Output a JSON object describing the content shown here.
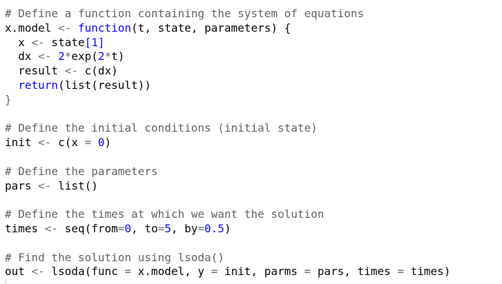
{
  "editor": {
    "lines": [
      [
        {
          "t": "# Define a function containing the system of equations",
          "c": "comment"
        }
      ],
      [
        {
          "t": "x.model",
          "c": "id"
        },
        {
          "t": " ",
          "c": "id"
        },
        {
          "t": "<-",
          "c": "op"
        },
        {
          "t": " ",
          "c": "id"
        },
        {
          "t": "function",
          "c": "kw"
        },
        {
          "t": "(t, state, parameters) {",
          "c": "id"
        }
      ],
      [
        {
          "t": "  x ",
          "c": "id"
        },
        {
          "t": "<-",
          "c": "op"
        },
        {
          "t": " state",
          "c": "id"
        },
        {
          "t": "[",
          "c": "kw"
        },
        {
          "t": "1",
          "c": "num"
        },
        {
          "t": "]",
          "c": "kw"
        }
      ],
      [
        {
          "t": "  dx ",
          "c": "id"
        },
        {
          "t": "<-",
          "c": "op"
        },
        {
          "t": " ",
          "c": "id"
        },
        {
          "t": "2",
          "c": "num"
        },
        {
          "t": "*",
          "c": "op"
        },
        {
          "t": "exp(",
          "c": "id"
        },
        {
          "t": "2",
          "c": "num"
        },
        {
          "t": "*",
          "c": "op"
        },
        {
          "t": "t)",
          "c": "id"
        }
      ],
      [
        {
          "t": "  result ",
          "c": "id"
        },
        {
          "t": "<-",
          "c": "op"
        },
        {
          "t": " c(dx)",
          "c": "id"
        }
      ],
      [
        {
          "t": "  ",
          "c": "id"
        },
        {
          "t": "return",
          "c": "kw"
        },
        {
          "t": "(list(result))",
          "c": "id"
        }
      ],
      [
        {
          "t": "}",
          "c": "op"
        }
      ],
      [
        {
          "t": "",
          "c": "id"
        }
      ],
      [
        {
          "t": "# Define the initial conditions (initial state)",
          "c": "comment"
        }
      ],
      [
        {
          "t": "init ",
          "c": "id"
        },
        {
          "t": "<-",
          "c": "op"
        },
        {
          "t": " c(x ",
          "c": "id"
        },
        {
          "t": "=",
          "c": "op"
        },
        {
          "t": " ",
          "c": "id"
        },
        {
          "t": "0",
          "c": "num"
        },
        {
          "t": ")",
          "c": "id"
        }
      ],
      [
        {
          "t": "",
          "c": "id"
        }
      ],
      [
        {
          "t": "# Define the parameters",
          "c": "comment"
        }
      ],
      [
        {
          "t": "pars ",
          "c": "id"
        },
        {
          "t": "<-",
          "c": "op"
        },
        {
          "t": " list()",
          "c": "id"
        }
      ],
      [
        {
          "t": "",
          "c": "id"
        }
      ],
      [
        {
          "t": "# Define the times at which we want the solution",
          "c": "comment"
        }
      ],
      [
        {
          "t": "times ",
          "c": "id"
        },
        {
          "t": "<-",
          "c": "op"
        },
        {
          "t": " seq(from",
          "c": "id"
        },
        {
          "t": "=",
          "c": "op"
        },
        {
          "t": "0",
          "c": "num"
        },
        {
          "t": ", to",
          "c": "id"
        },
        {
          "t": "=",
          "c": "op"
        },
        {
          "t": "5",
          "c": "num"
        },
        {
          "t": ", by",
          "c": "id"
        },
        {
          "t": "=",
          "c": "op"
        },
        {
          "t": "0.5",
          "c": "num"
        },
        {
          "t": ")",
          "c": "id"
        }
      ],
      [
        {
          "t": "",
          "c": "id"
        }
      ],
      [
        {
          "t": "# Find the solution using lsoda()",
          "c": "comment"
        }
      ],
      [
        {
          "t": "out ",
          "c": "id"
        },
        {
          "t": "<-",
          "c": "op"
        },
        {
          "t": " lsoda(func ",
          "c": "id"
        },
        {
          "t": "=",
          "c": "op"
        },
        {
          "t": " x.model, y ",
          "c": "id"
        },
        {
          "t": "=",
          "c": "op"
        },
        {
          "t": " init, parms ",
          "c": "id"
        },
        {
          "t": "=",
          "c": "op"
        },
        {
          "t": " pars, times ",
          "c": "id"
        },
        {
          "t": "=",
          "c": "op"
        },
        {
          "t": " times)",
          "c": "id"
        }
      ]
    ]
  }
}
